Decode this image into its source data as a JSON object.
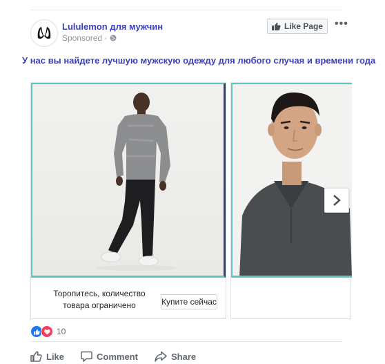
{
  "post": {
    "page_name": "Lululemon для мужчин",
    "sponsored": "Sponsored ·",
    "like_page": "Like Page",
    "more": "•••",
    "caption": "У нас вы найдете лучшую мужскую одежду для любого случая и времени года"
  },
  "carousel": {
    "cards": [
      {
        "text": "Торопитесь, количество товара ограничено",
        "cta": "Купите сейчас"
      }
    ]
  },
  "reactions": {
    "count": "10"
  },
  "actions": {
    "like": "Like",
    "comment": "Comment",
    "share": "Share"
  },
  "colors": {
    "brand_text": "#3b3fbf",
    "accent_border": "#5fc7bc",
    "like_blue": "#1877f2",
    "love_red": "#f33e58"
  },
  "icons": [
    "lululemon-logo",
    "globe-icon",
    "thumbs-up-icon",
    "more-icon",
    "chevron-right-icon",
    "heart-icon",
    "comment-icon",
    "share-icon"
  ]
}
